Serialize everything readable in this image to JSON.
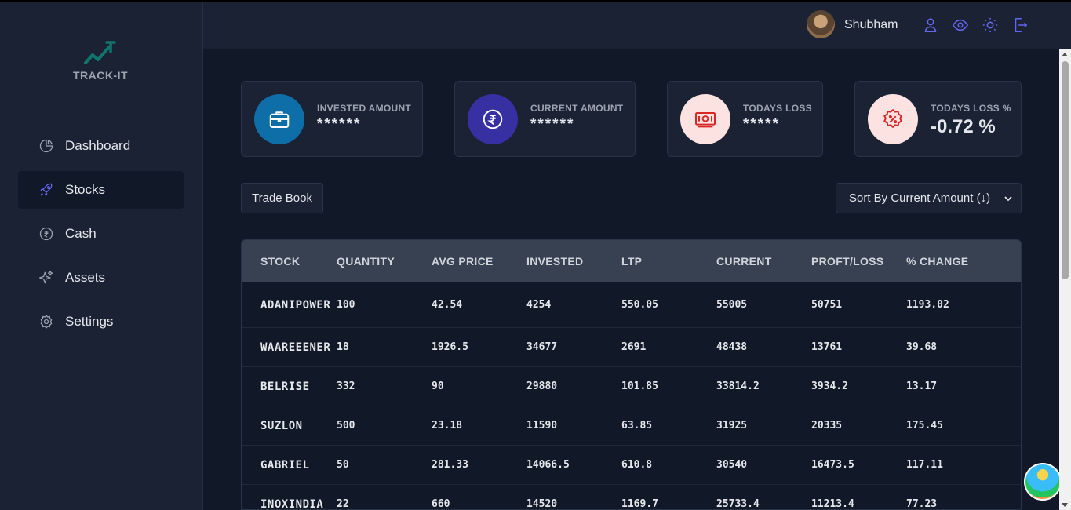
{
  "app": {
    "name": "TRACK-IT"
  },
  "sidebar": {
    "items": [
      {
        "label": "Dashboard",
        "icon": "pie-chart-icon",
        "active": false
      },
      {
        "label": "Stocks",
        "icon": "rocket-icon",
        "active": true
      },
      {
        "label": "Cash",
        "icon": "rupee-circle-icon",
        "active": false
      },
      {
        "label": "Assets",
        "icon": "sparkles-icon",
        "active": false
      },
      {
        "label": "Settings",
        "icon": "gear-icon",
        "active": false
      }
    ]
  },
  "header": {
    "username": "Shubham",
    "icons": [
      "user-icon",
      "eye-icon",
      "sun-icon",
      "logout-icon"
    ],
    "accent": "#6366f1"
  },
  "cards": [
    {
      "title": "INVESTED AMOUNT",
      "value": "******",
      "icon": "briefcase-icon",
      "bg": "#0e6fa8"
    },
    {
      "title": "CURRENT AMOUNT",
      "value": "******",
      "icon": "rupee-icon",
      "bg": "#3730a3"
    },
    {
      "title": "TODAYS LOSS",
      "value": "*****",
      "icon": "banknote-icon",
      "bg": "#fde2e2"
    },
    {
      "title": "TODAYS LOSS %",
      "value": "-0.72 %",
      "icon": "percent-badge-icon",
      "bg": "#fde2e2"
    }
  ],
  "controls": {
    "trade_book": "Trade Book",
    "sort_selected": "Sort By Current Amount (↓)"
  },
  "table": {
    "headers": [
      "STOCK",
      "QUANTITY",
      "AVG PRICE",
      "INVESTED",
      "LTP",
      "CURRENT",
      "PROFT/LOSS",
      "% CHANGE"
    ],
    "rows": [
      [
        "ADANIPOWER",
        "100",
        "42.54",
        "4254",
        "550.05",
        "55005",
        "50751",
        "1193.02"
      ],
      [
        "WAAREEENER",
        "18",
        "1926.5",
        "34677",
        "2691",
        "48438",
        "13761",
        "39.68"
      ],
      [
        "BELRISE",
        "332",
        "90",
        "29880",
        "101.85",
        "33814.2",
        "3934.2",
        "13.17"
      ],
      [
        "SUZLON",
        "500",
        "23.18",
        "11590",
        "63.85",
        "31925",
        "20335",
        "175.45"
      ],
      [
        "GABRIEL",
        "50",
        "281.33",
        "14066.5",
        "610.8",
        "30540",
        "16473.5",
        "117.11"
      ],
      [
        "INOXINDIA",
        "22",
        "660",
        "14520",
        "1169.7",
        "25733.4",
        "11213.4",
        "77.23"
      ]
    ]
  }
}
